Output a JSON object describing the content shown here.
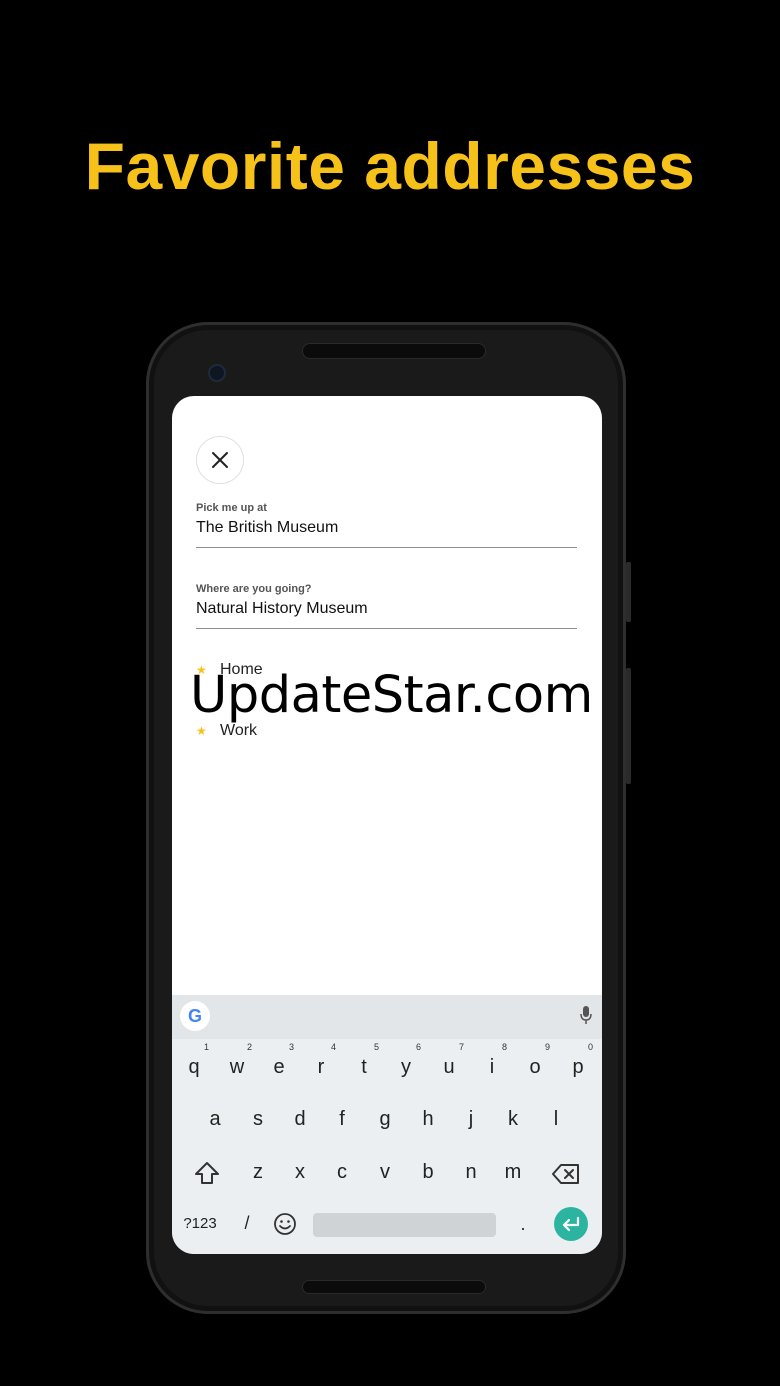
{
  "headline": "Favorite addresses",
  "pickup": {
    "label": "Pick me up at",
    "value": "The British Museum"
  },
  "destination": {
    "label": "Where are you going?",
    "value": "Natural History Museum"
  },
  "favorites": [
    {
      "name": "Home",
      "icon": "star-icon"
    },
    {
      "name": "Work",
      "icon": "star-icon"
    }
  ],
  "watermark": "UpdateStar.com",
  "keyboard": {
    "row1": [
      "q",
      "w",
      "e",
      "r",
      "t",
      "y",
      "u",
      "i",
      "o",
      "p"
    ],
    "row1_numbers": [
      "1",
      "2",
      "3",
      "4",
      "5",
      "6",
      "7",
      "8",
      "9",
      "0"
    ],
    "row2": [
      "a",
      "s",
      "d",
      "f",
      "g",
      "h",
      "j",
      "k",
      "l"
    ],
    "row3": [
      "z",
      "x",
      "c",
      "v",
      "b",
      "n",
      "m"
    ],
    "symbols_label": "?123",
    "slash": "/",
    "period": ".",
    "google_label": "G"
  },
  "colors": {
    "accent": "#F6C21A",
    "enter": "#2BB5A0"
  }
}
